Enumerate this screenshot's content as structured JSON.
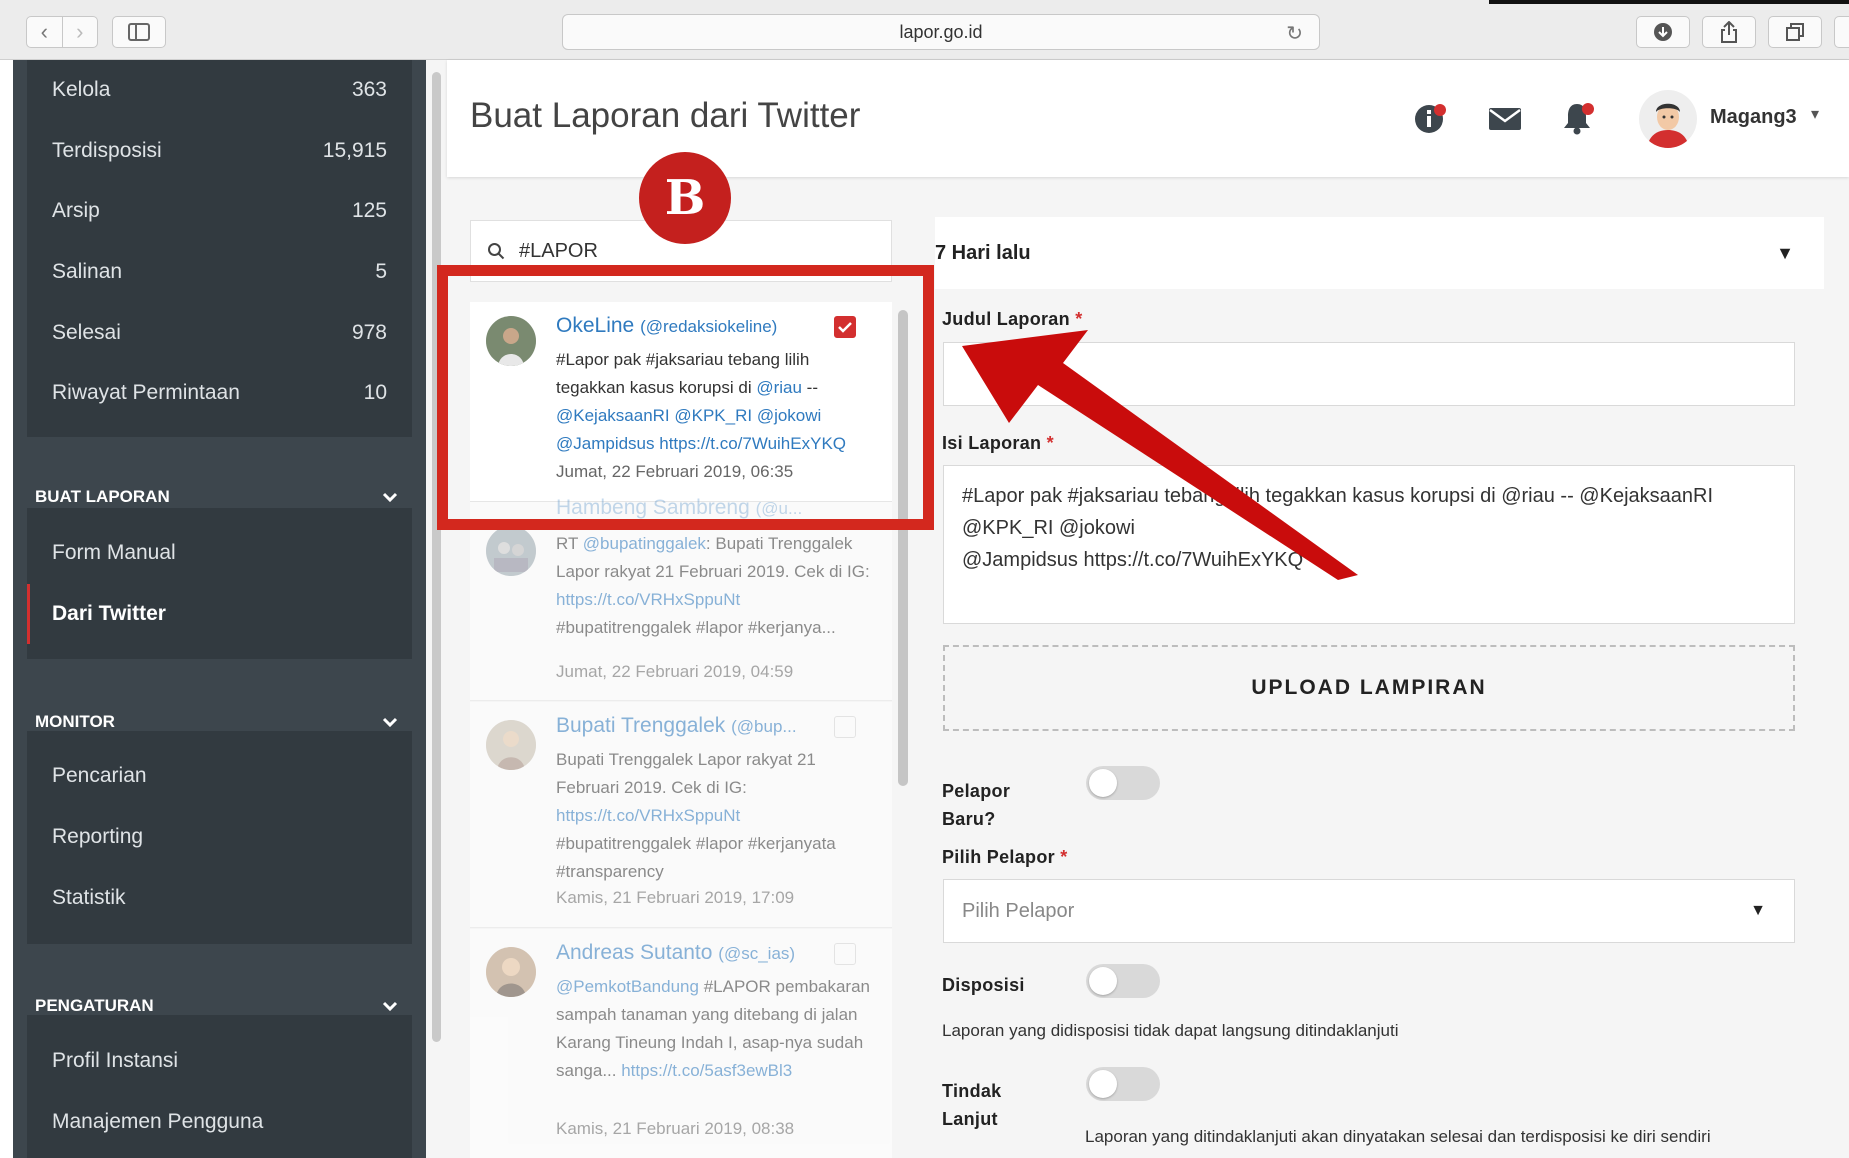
{
  "browser": {
    "url": "lapor.go.id"
  },
  "sidebar": {
    "inbox_items": [
      {
        "label": "Kelola",
        "count": "363"
      },
      {
        "label": "Terdisposisi",
        "count": "15,915"
      },
      {
        "label": "Arsip",
        "count": "125"
      },
      {
        "label": "Salinan",
        "count": "5"
      },
      {
        "label": "Selesai",
        "count": "978"
      },
      {
        "label": "Riwayat Permintaan",
        "count": "10"
      }
    ],
    "sections": [
      {
        "title": "BUAT LAPORAN",
        "items": [
          "Form Manual",
          "Dari Twitter"
        ],
        "active": "Dari Twitter"
      },
      {
        "title": "MONITOR",
        "items": [
          "Pencarian",
          "Reporting",
          "Statistik"
        ]
      },
      {
        "title": "PENGATURAN",
        "items": [
          "Profil Instansi",
          "Manajemen Pengguna"
        ]
      }
    ]
  },
  "header": {
    "title": "Buat Laporan dari Twitter",
    "user_name": "Magang3"
  },
  "twitter": {
    "search_value": "#LAPOR",
    "tweets": [
      {
        "name": "OkeLine",
        "handle": "(@redaksiokeline)",
        "text_parts": [
          {
            "t": "#Lapor pak #jaksariau tebang lilih tegakkan kasus korupsi di "
          },
          {
            "t": "@riau",
            "link": true
          },
          {
            "t": " -- "
          },
          {
            "t": "@KejaksaanRI @KPK_RI @jokowi @Jampidsus https://t.co/7WuihExYKQ",
            "link": true
          }
        ],
        "date": "Jumat, 22 Februari 2019, 06:35",
        "checked": true
      },
      {
        "name": "Hambeng Sambreng",
        "handle": "(@u...",
        "text_parts": [
          {
            "t": "RT "
          },
          {
            "t": "@bupatinggalek",
            "link": true
          },
          {
            "t": ": Bupati Trenggalek Lapor rakyat 21 Februari 2019. Cek di IG: "
          },
          {
            "t": "https://t.co/VRHxSppuNt",
            "link": true
          },
          {
            "t": " #bupatitrenggalek #lapor #kerjanya..."
          }
        ],
        "date": "Jumat, 22 Februari 2019, 04:59",
        "checked": false
      },
      {
        "name": "Bupati Trenggalek",
        "handle": "(@bup...",
        "text_parts": [
          {
            "t": "Bupati Trenggalek Lapor rakyat 21 Februari 2019. Cek di IG: "
          },
          {
            "t": "https://t.co/VRHxSppuNt",
            "link": true
          },
          {
            "t": " #bupatitrenggalek #lapor #kerjanyata #transparency"
          }
        ],
        "date": "Kamis, 21 Februari 2019, 17:09",
        "checked": false
      },
      {
        "name": "Andreas Sutanto",
        "handle": "(@sc_ias)",
        "text_parts": [
          {
            "t": "@PemkotBandung",
            "link": true
          },
          {
            "t": " #LAPOR pembakaran sampah tanaman yang ditebang di jalan Karang Tineung Indah I, asap-nya sudah sanga... "
          },
          {
            "t": "https://t.co/5asf3ewBl3",
            "link": true
          }
        ],
        "date": "Kamis, 21 Februari 2019, 08:38",
        "checked": false
      }
    ]
  },
  "form": {
    "period": "7 Hari lalu",
    "judul_label": "Judul Laporan",
    "judul_value": "",
    "isi_label": "Isi Laporan",
    "isi_value": "#Lapor pak #jaksariau tebang lilih tegakkan kasus korupsi di @riau -- @KejaksaanRI @KPK_RI @jokowi\n@Jampidsus https://t.co/7WuihExYKQ",
    "upload_label": "UPLOAD LAMPIRAN",
    "pelapor_baru_label_1": "Pelapor",
    "pelapor_baru_label_2": "Baru?",
    "pelapor_baru_on": false,
    "pilih_pelapor_label": "Pilih Pelapor",
    "pilih_pelapor_placeholder": "Pilih Pelapor",
    "disposisi_label": "Disposisi",
    "disposisi_on": false,
    "disposisi_help": "Laporan yang didisposisi tidak dapat langsung ditindaklanjuti",
    "tindak_label_1": "Tindak",
    "tindak_label_2": "Lanjut",
    "tindak_on": false,
    "tindak_help": "Laporan yang ditindaklanjuti akan dinyatakan selesai dan terdisposisi ke diri sendiri",
    "required_mark": "*"
  },
  "annotation": {
    "badge_letter": "B",
    "color": "#d3281e"
  },
  "colors": {
    "sidebar_bg": "#3d464d",
    "sidebar_group_bg": "#323a40",
    "accent": "#d32f2f",
    "link": "#2f7abf"
  }
}
